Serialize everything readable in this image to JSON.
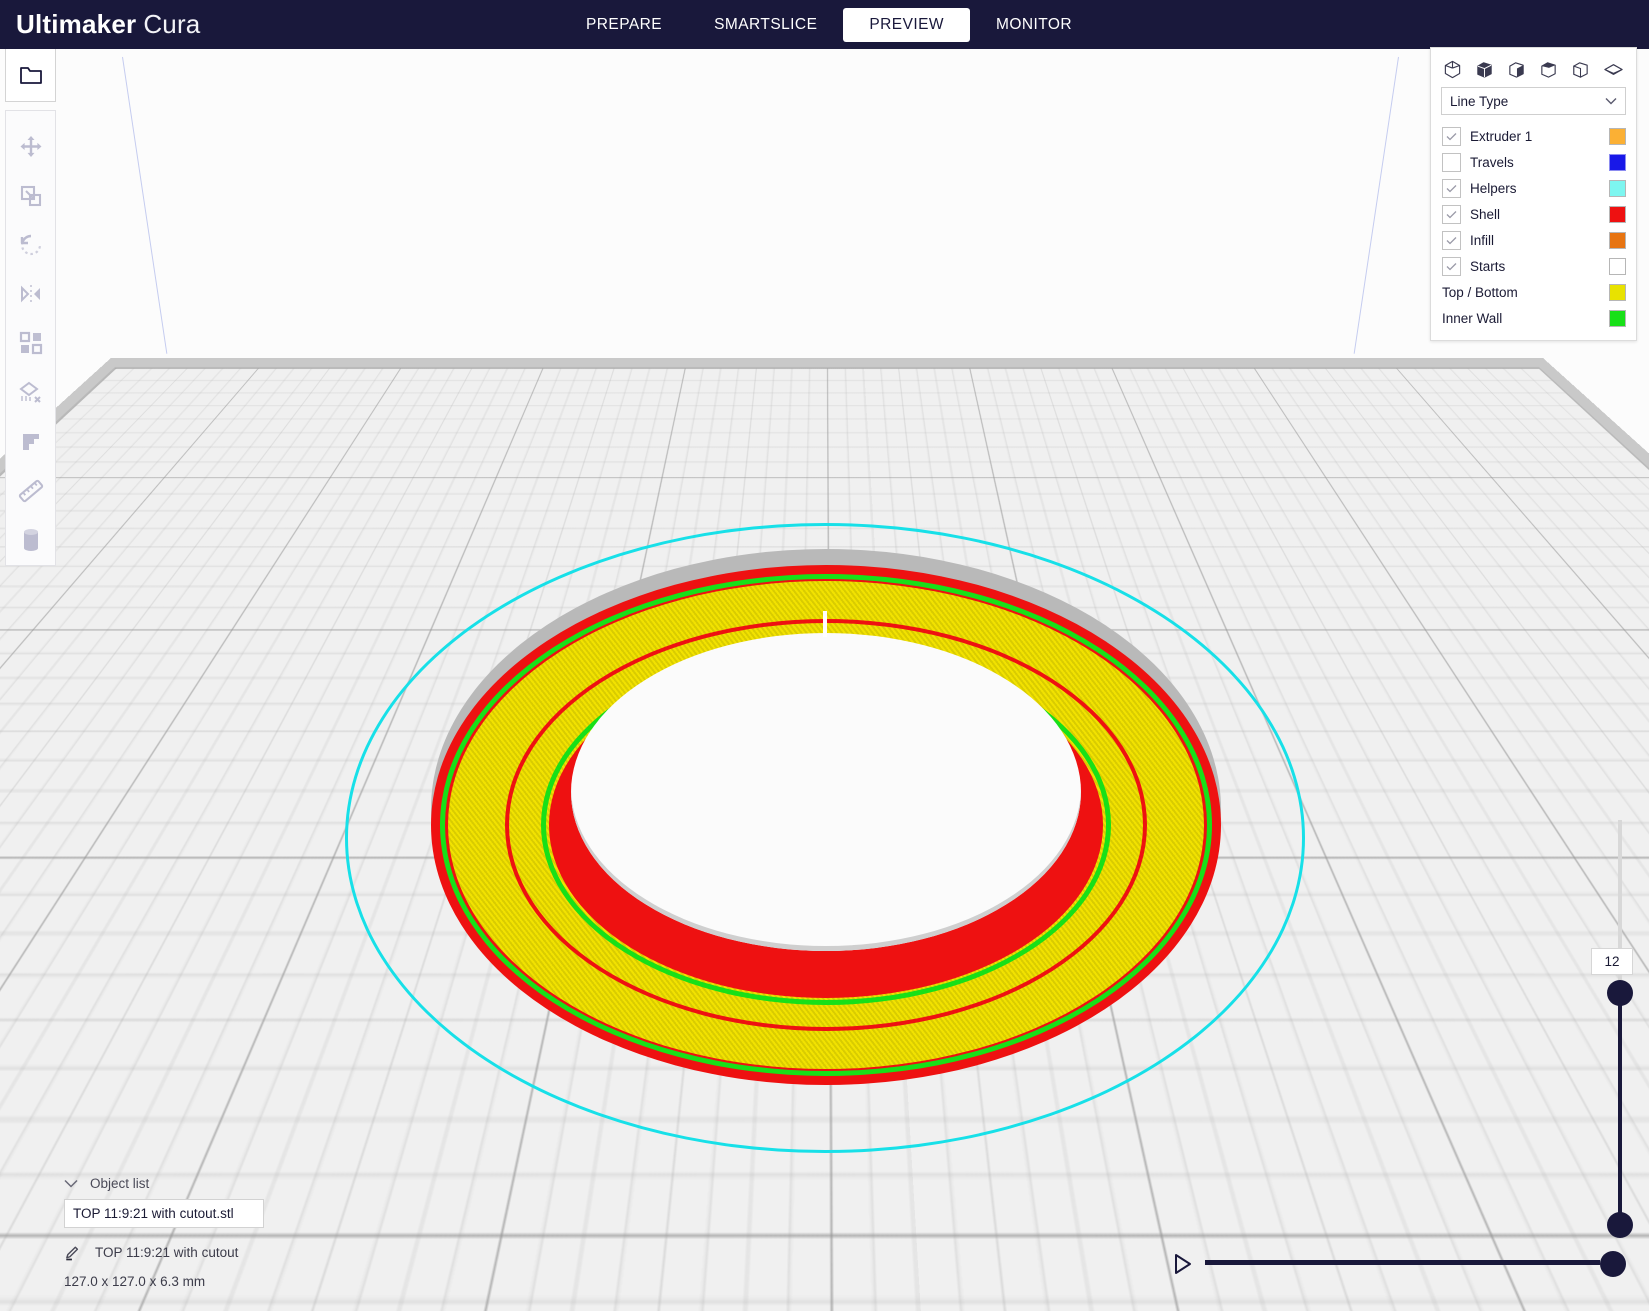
{
  "app": {
    "brand_bold": "Ultimaker",
    "brand_light": "Cura"
  },
  "tabs": [
    {
      "label": "PREPARE",
      "active": false
    },
    {
      "label": "SMARTSLICE",
      "active": false
    },
    {
      "label": "PREVIEW",
      "active": true
    },
    {
      "label": "MONITOR",
      "active": false
    }
  ],
  "toolbar": {
    "open_file": "open-folder-icon",
    "items": [
      {
        "name": "move-icon"
      },
      {
        "name": "scale-icon"
      },
      {
        "name": "rotate-icon"
      },
      {
        "name": "mirror-icon"
      },
      {
        "name": "per-model-settings-icon"
      },
      {
        "name": "support-blocker-icon"
      },
      {
        "name": "step-layer-icon"
      },
      {
        "name": "measure-icon"
      },
      {
        "name": "cylinder-icon"
      }
    ]
  },
  "legend": {
    "view_icons": [
      "iso-view-icon",
      "front-view-icon",
      "top-view-icon",
      "left-view-icon",
      "right-view-icon",
      "layer-view-icon"
    ],
    "color_scheme": {
      "label": "Line Type",
      "chevron": "chevron-down-icon"
    },
    "items": [
      {
        "label": "Extruder 1",
        "checkbox": true,
        "checked": true,
        "color": "#fbb034"
      },
      {
        "label": "Travels",
        "checkbox": true,
        "checked": false,
        "color": "#1818e8"
      },
      {
        "label": "Helpers",
        "checkbox": true,
        "checked": true,
        "color": "#7df6f0"
      },
      {
        "label": "Shell",
        "checkbox": true,
        "checked": true,
        "color": "#ee1111"
      },
      {
        "label": "Infill",
        "checkbox": true,
        "checked": true,
        "color": "#e77412"
      },
      {
        "label": "Starts",
        "checkbox": true,
        "checked": true,
        "color": "#ffffff"
      },
      {
        "label": "Top / Bottom",
        "checkbox": false,
        "checked": false,
        "color": "#e8e200"
      },
      {
        "label": "Inner Wall",
        "checkbox": false,
        "checked": false,
        "color": "#18e018"
      }
    ]
  },
  "object_list": {
    "header": "Object list",
    "chevron": "chevron-down-icon",
    "selected_file": "TOP 11:9:21 with cutout.stl",
    "edit_icon": "pencil-icon",
    "selected_name": "TOP 11:9:21 with cutout",
    "dimensions": "127.0 x 127.0 x 6.3 mm"
  },
  "sliders": {
    "layer_value": "12",
    "play_icon": "play-icon"
  },
  "colors": {
    "brand_navy": "#19183b",
    "accent_white": "#ffffff",
    "plate_grid": "#969696"
  }
}
